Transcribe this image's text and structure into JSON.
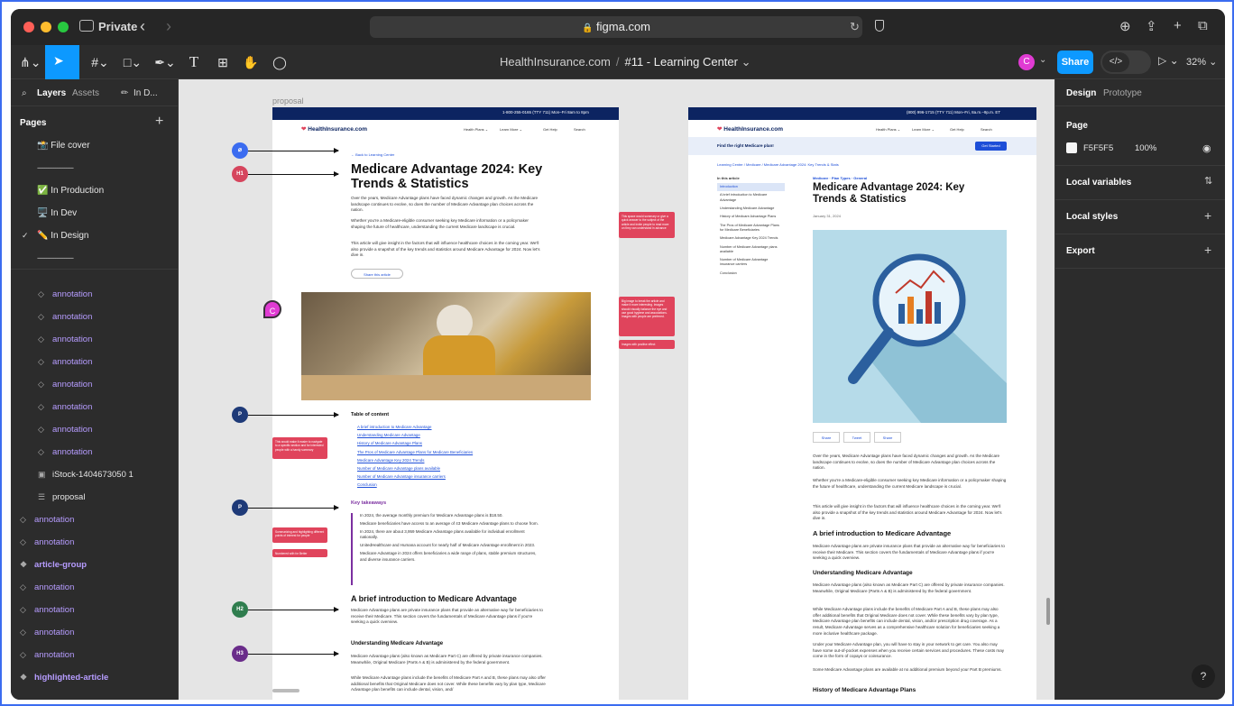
{
  "browser": {
    "private_label": "Private",
    "url": "figma.com"
  },
  "toolbar": {
    "file_breadcrumb_team": "HealthInsurance.com",
    "file_breadcrumb_sep": "/",
    "file_breadcrumb_file": "#11 - Learning Center",
    "user_avatar": "C",
    "share_label": "Share",
    "zoom": "32%"
  },
  "left_panel": {
    "tab_layers": "Layers",
    "tab_assets": "Assets",
    "tab_page": "In D...",
    "pages_heading": "Pages",
    "pages": [
      {
        "label": "📸 File cover"
      },
      {
        "label": "--------------------"
      },
      {
        "label": "✅ In Production"
      },
      {
        "label": "🖥️ In Dev"
      },
      {
        "label": "✏️ In Design"
      },
      {
        "label": "--------------------"
      }
    ],
    "layers": [
      {
        "label": "annotation",
        "kind": "instance"
      },
      {
        "label": "annotation",
        "kind": "instance"
      },
      {
        "label": "annotation",
        "kind": "instance"
      },
      {
        "label": "annotation",
        "kind": "instance"
      },
      {
        "label": "annotation",
        "kind": "instance"
      },
      {
        "label": "annotation",
        "kind": "instance"
      },
      {
        "label": "annotation",
        "kind": "instance"
      },
      {
        "label": "annotation",
        "kind": "instance"
      },
      {
        "label": "iStock-1404673050 1",
        "kind": "image"
      },
      {
        "label": "proposal",
        "kind": "text"
      },
      {
        "label": "annotation",
        "kind": "instance"
      },
      {
        "label": "annotation",
        "kind": "instance"
      },
      {
        "label": "article-group",
        "kind": "component"
      },
      {
        "label": "annotation",
        "kind": "instance"
      },
      {
        "label": "annotation",
        "kind": "instance"
      },
      {
        "label": "annotation",
        "kind": "instance"
      },
      {
        "label": "annotation",
        "kind": "instance"
      },
      {
        "label": "highlighted-article",
        "kind": "component"
      }
    ]
  },
  "canvas": {
    "frame_label": "proposal",
    "cursor_user": "C",
    "left_board": {
      "phone": "1-800-255-0165 (TTY 711)  Mon–Fri 8am to 8pm",
      "logo": "HealthInsurance.com",
      "nav": [
        "Health Plans ⌄",
        "Learn More ⌄",
        "Get Help",
        "Search"
      ],
      "back_link": "← Back to Learning Center",
      "title": "Medicare Advantage 2024: Key Trends & Statistics",
      "intro_paragraphs": [
        "Over the years, Medicare Advantage plans have faced dynamic changes and growth. As the Medicare landscape continues to evolve, so does the number of Medicare Advantage plan choices across the nation.",
        "Whether you're a Medicare-eligible consumer seeking key Medicare information or a policymaker shaping the future of healthcare, understanding the current Medicare landscape is crucial.",
        "This article will give insight in the factors that will influence healthcare choices in the coming year. We'll also provide a snapshot of the key trends and statistics around Medicare Advantage for 2024. Now let's dive in."
      ],
      "share_button": "Share this article",
      "toc_heading": "Table of content",
      "toc": [
        "A brief introduction to Medicare Advantage",
        "Understanding Medicare Advantage",
        "History of Medicare Advantage Plans",
        "The Pros of Medicare Advantage Plans for Medicare Beneficiaries",
        "Medicare Advantage Key 2024 Trends",
        "Number of Medicare Advantage plans available",
        "Number of Medicare Advantage insurance carriers",
        "Conclusion"
      ],
      "takeaways_heading": "Key takeaways",
      "takeaways": [
        "In 2024, the average monthly premium for Medicare Advantage plans is $18.50.",
        "Medicare beneficiaries have access to an average of 43 Medicare Advantage plans to choose from.",
        "In 2024, there are about 3,959 Medicare Advantage plans available for individual enrollment nationally.",
        "UnitedHealthcare and Humana account for nearly half of Medicare Advantage enrollment in 2023.",
        "Medicare Advantage in 2024 offers beneficiaries a wide range of plans, stable premium structures, and diverse insurance carriers."
      ],
      "h2": "A brief introduction to Medicare Advantage",
      "h2_para": "Medicare Advantage plans are private insurance plans that provide an alternative way for beneficiaries to receive their Medicare. This section covers the fundamentals of Medicare Advantage plans if you're seeking a quick overview.",
      "h3": "Understanding Medicare Advantage",
      "h3_para1": "Medicare Advantage plans (also known as Medicare Part C) are offered by private insurance companies. Meanwhile, Original Medicare (Parts A & B) is administered by the federal government.",
      "h3_para2": "While Medicare Advantage plans include the benefits of Medicare Part A and B, these plans may also offer additional benefits that Original Medicare does not cover. While these benefits vary by plan type, Medicare Advantage plan benefits can include dental, vision, and/"
    },
    "annotations": [
      "",
      "H1",
      "P",
      "P",
      "H2",
      "H3"
    ],
    "notes": [
      "This space would summary or give a quick answer to the subject of the article and invite people to read more on they can understand in advance",
      "Big image to break the article and make it more interesting. Images should visually balance the eye and use good hygiene and associations. Images with people are preferred.",
      "Images with positive effect",
      "This would make it easier to navigate to a specific section and for interested people with a handy summary",
      "Summarizing and highlighting different points of interest for people",
      "Numbered with for Better"
    ],
    "right_board": {
      "phone": "(800) 996-1715 (TTY 711)  Mon–Fri, 8a.m.–9p.m. ET",
      "logo": "HealthInsurance.com",
      "nav": [
        "Health Plans ⌄",
        "Learn More ⌄",
        "Get Help",
        "Search"
      ],
      "banner": "Find the right Medicare plan!",
      "banner_button": "Get Started",
      "breadcrumb": "Learning Center / Medicare / Medicare Advantage 2024: Key Trends & Stats",
      "toc_heading": "In this article",
      "toc": [
        "Introduction",
        "A brief introduction to Medicare Advantage",
        "Understanding Medicare Advantage",
        "History of Medicare Advantage Plans",
        "The Pros of Medicare Advantage Plans for Medicare Beneficiaries",
        "Medicare Advantage Key 2024 Trends",
        "Number of Medicare Advantage plans available",
        "Number of Medicare Advantage insurance carriers",
        "Conclusion"
      ],
      "category": "Medicare · Plan Types · General",
      "title": "Medicare Advantage 2024: Key Trends & Statistics",
      "date": "January 31, 2024",
      "share": [
        "Share",
        "Tweet",
        "Share"
      ],
      "p1": "Over the years, Medicare Advantage plans have faced dynamic changes and growth. As the Medicare landscape continues to evolve, so does the number of Medicare Advantage plan choices across the nation.",
      "p2": "Whether you're a Medicare-eligible consumer seeking key Medicare information or a policymaker shaping the future of healthcare, understanding the current Medicare landscape is crucial.",
      "p3": "This article will give insight in the factors that will influence healthcare choices in the coming year. We'll also provide a snapshot of the key trends and statistics around Medicare Advantage for 2024. Now let's dive in.",
      "h2": "A brief introduction to Medicare Advantage",
      "p4": "Medicare Advantage plans are private insurance plans that provide an alternative way for beneficiaries to receive their Medicare. This section covers the fundamentals of Medicare Advantage plans if you're seeking a quick overview.",
      "h3": "Understanding Medicare Advantage",
      "p5": "Medicare Advantage plans (also known as Medicare Part C) are offered by private insurance companies. Meanwhile, Original Medicare (Parts A & B) is administered by the federal government.",
      "p6": "While Medicare Advantage plans include the benefits of Medicare Part A and B, these plans may also offer additional benefits that Original Medicare does not cover. While these benefits vary by plan type, Medicare Advantage plan benefits can include dental, vision, and/or prescription drug coverage. As a result, Medicare Advantage serves as a comprehensive healthcare solution for beneficiaries seeking a more inclusive healthcare package.",
      "p7": "Under your Medicare Advantage plan, you will have to stay in your network to get care. You also may have some out-of-pocket expenses when you receive certain services and procedures. These costs may come in the form of copays or coinsurance.",
      "p8": "Some Medicare Advantage plans are available at no additional premium beyond your Part B premiums.",
      "h3b": "History of Medicare Advantage Plans"
    }
  },
  "right_panel": {
    "tab_design": "Design",
    "tab_prototype": "Prototype",
    "page_heading": "Page",
    "bg_color": "F5F5F5",
    "bg_opacity": "100%",
    "local_variables": "Local variables",
    "local_styles": "Local styles",
    "export": "Export"
  },
  "colors": {
    "accent": "#0d99ff",
    "annotation": "#e0445c",
    "h1_badge": "#d6455d",
    "p_badge": "#1e3a78",
    "h2_badge": "#2f7d4e",
    "h3_badge": "#6a2c8a",
    "brand_navy": "#0c2461"
  },
  "help": "?"
}
